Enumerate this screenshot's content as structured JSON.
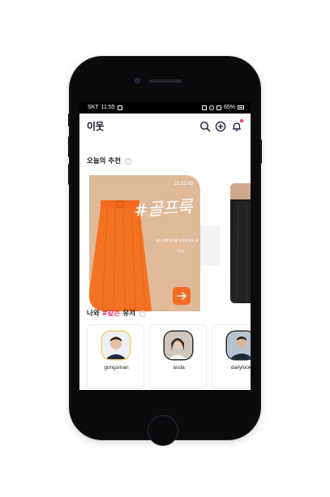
{
  "statusbar": {
    "carrier": "SKT",
    "time": "11:55",
    "battery": "65%"
  },
  "app": {
    "logo": "이웃",
    "brand_color": "#141a33",
    "accent_color": "#e8326b"
  },
  "header_icons": [
    "search-icon",
    "add-circle-icon",
    "bell-icon"
  ],
  "recommendations": {
    "title": "오늘의 추천",
    "info_label": "?",
    "card": {
      "date": "22.03.03",
      "hashtag": "#골프룩",
      "caption": "필드 위를 빛내줄 당신의 골프 룩",
      "user": "지미",
      "background": "#e0b999",
      "arrow_color": "#f26d21"
    }
  },
  "similar_users": {
    "title_prefix": "나와 ",
    "title_accent": "#같은",
    "title_suffix": " 유저",
    "info_label": "?",
    "users": [
      {
        "name": "gongsman"
      },
      {
        "name": "aoda"
      },
      {
        "name": "dailylook"
      }
    ]
  }
}
